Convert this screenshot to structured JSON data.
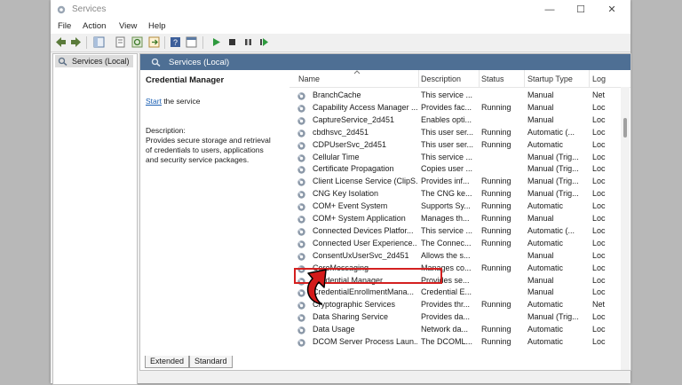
{
  "window": {
    "title": "Services"
  },
  "menu": [
    "File",
    "Action",
    "View",
    "Help"
  ],
  "tree": {
    "root_label": "Services (Local)"
  },
  "main": {
    "header": "Services (Local)"
  },
  "details": {
    "title": "Credential Manager",
    "start_link": "Start",
    "start_suffix": " the service",
    "description_label": "Description:",
    "description_lines": [
      "Provides secure storage and retrieval",
      "of credentials to users, applications",
      "and security service packages."
    ]
  },
  "list": {
    "columns": [
      "Name",
      "Description",
      "Status",
      "Startup Type",
      "Log"
    ],
    "rows": [
      {
        "name": "BranchCache",
        "description": "This service ...",
        "status": "",
        "startup": "Manual",
        "log": "Net"
      },
      {
        "name": "Capability Access Manager ...",
        "description": "Provides fac...",
        "status": "Running",
        "startup": "Manual",
        "log": "Loc"
      },
      {
        "name": "CaptureService_2d451",
        "description": "Enables opti...",
        "status": "",
        "startup": "Manual",
        "log": "Loc"
      },
      {
        "name": "cbdhsvc_2d451",
        "description": "This user ser...",
        "status": "Running",
        "startup": "Automatic (...",
        "log": "Loc"
      },
      {
        "name": "CDPUserSvc_2d451",
        "description": "This user ser...",
        "status": "Running",
        "startup": "Automatic",
        "log": "Loc"
      },
      {
        "name": "Cellular Time",
        "description": "This service ...",
        "status": "",
        "startup": "Manual (Trig...",
        "log": "Loc"
      },
      {
        "name": "Certificate Propagation",
        "description": "Copies user ...",
        "status": "",
        "startup": "Manual (Trig...",
        "log": "Loc"
      },
      {
        "name": "Client License Service (ClipS...",
        "description": "Provides inf...",
        "status": "Running",
        "startup": "Manual (Trig...",
        "log": "Loc"
      },
      {
        "name": "CNG Key Isolation",
        "description": "The CNG ke...",
        "status": "Running",
        "startup": "Manual (Trig...",
        "log": "Loc"
      },
      {
        "name": "COM+ Event System",
        "description": "Supports Sy...",
        "status": "Running",
        "startup": "Automatic",
        "log": "Loc"
      },
      {
        "name": "COM+ System Application",
        "description": "Manages th...",
        "status": "Running",
        "startup": "Manual",
        "log": "Loc"
      },
      {
        "name": "Connected Devices Platfor...",
        "description": "This service ...",
        "status": "Running",
        "startup": "Automatic (...",
        "log": "Loc"
      },
      {
        "name": "Connected User Experience...",
        "description": "The Connec...",
        "status": "Running",
        "startup": "Automatic",
        "log": "Loc"
      },
      {
        "name": "ConsentUxUserSvc_2d451",
        "description": "Allows the s...",
        "status": "",
        "startup": "Manual",
        "log": "Loc"
      },
      {
        "name": "CoreMessaging",
        "description": "Manages co...",
        "status": "Running",
        "startup": "Automatic",
        "log": "Loc"
      },
      {
        "name": "Credential Manager",
        "description": "Provides se...",
        "status": "",
        "startup": "Manual",
        "log": "Loc"
      },
      {
        "name": "CredentialEnrollmentMana...",
        "description": "Credential E...",
        "status": "",
        "startup": "Manual",
        "log": "Loc"
      },
      {
        "name": "Cryptographic Services",
        "description": "Provides thr...",
        "status": "Running",
        "startup": "Automatic",
        "log": "Net"
      },
      {
        "name": "Data Sharing Service",
        "description": "Provides da...",
        "status": "",
        "startup": "Manual (Trig...",
        "log": "Loc"
      },
      {
        "name": "Data Usage",
        "description": "Network da...",
        "status": "Running",
        "startup": "Automatic",
        "log": "Loc"
      },
      {
        "name": "DCOM Server Process Laun...",
        "description": "The DCOML...",
        "status": "Running",
        "startup": "Automatic",
        "log": "Loc"
      }
    ]
  },
  "tabs": [
    "Extended",
    "Standard"
  ],
  "colors": {
    "header_bg": "#4e6f94",
    "highlight": "#d42020",
    "link": "#1a5fb4"
  }
}
